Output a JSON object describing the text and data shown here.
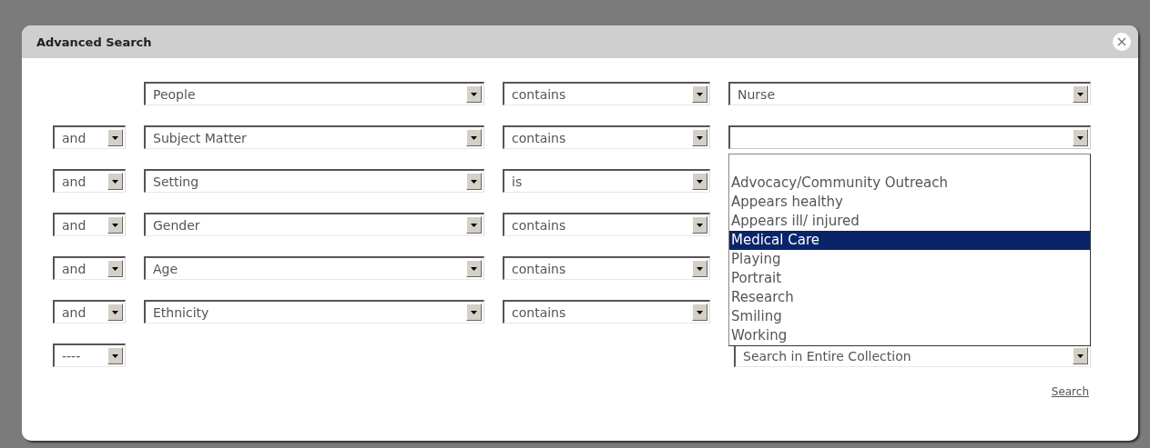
{
  "dialog": {
    "title": "Advanced Search"
  },
  "criteria": [
    {
      "field": "People",
      "operator": "contains",
      "value": {
        "text": "Nurse",
        "expanded": false
      }
    },
    {
      "connector": "and",
      "field": "Subject Matter",
      "operator": "contains",
      "value": {
        "expanded": true,
        "options": [
          {
            "label": "Advocacy/Community Outreach",
            "selected": false
          },
          {
            "label": "Appears healthy",
            "selected": false
          },
          {
            "label": "Appears ill/ injured",
            "selected": false
          },
          {
            "label": "Medical Care",
            "selected": true
          },
          {
            "label": "Playing",
            "selected": false
          },
          {
            "label": "Portrait",
            "selected": false
          },
          {
            "label": "Research",
            "selected": false
          },
          {
            "label": "Smiling",
            "selected": false
          },
          {
            "label": "Working",
            "selected": false
          }
        ]
      }
    },
    {
      "connector": "and",
      "field": "Setting",
      "operator": "is"
    },
    {
      "connector": "and",
      "field": "Gender",
      "operator": "contains"
    },
    {
      "connector": "and",
      "field": "Age",
      "operator": "contains"
    },
    {
      "connector": "and",
      "field": "Ethnicity",
      "operator": "contains"
    }
  ],
  "footer": {
    "connector": "----",
    "scope": "Search in Entire Collection"
  },
  "search_link": "Search"
}
